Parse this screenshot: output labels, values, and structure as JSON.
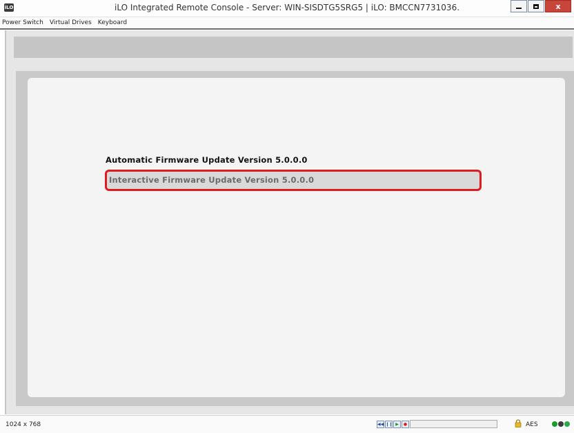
{
  "window": {
    "icon_label": "iLO",
    "title": "iLO Integrated Remote Console - Server: WIN-SISDTG5SRG5 | iLO: BMCCN7731036.",
    "close_label": "x"
  },
  "menubar": {
    "items": [
      {
        "label": "Power Switch"
      },
      {
        "label": "Virtual Drives"
      },
      {
        "label": "Keyboard"
      }
    ]
  },
  "console": {
    "options": [
      {
        "label": "Automatic Firmware Update Version 5.0.0.0"
      },
      {
        "label": "Interactive Firmware Update Version 5.0.0.0",
        "highlighted": true
      }
    ]
  },
  "statusbar": {
    "resolution": "1024 x 768",
    "encryption": "AES",
    "media_buttons": [
      "rewind-icon",
      "pause-icon",
      "play-icon",
      "record-icon"
    ],
    "led_colors": [
      "#1a9c2a",
      "#3a3a3a",
      "#2ba84a"
    ]
  },
  "colors": {
    "highlight_border": "#e01b1b",
    "close_button": "#c8453a"
  }
}
